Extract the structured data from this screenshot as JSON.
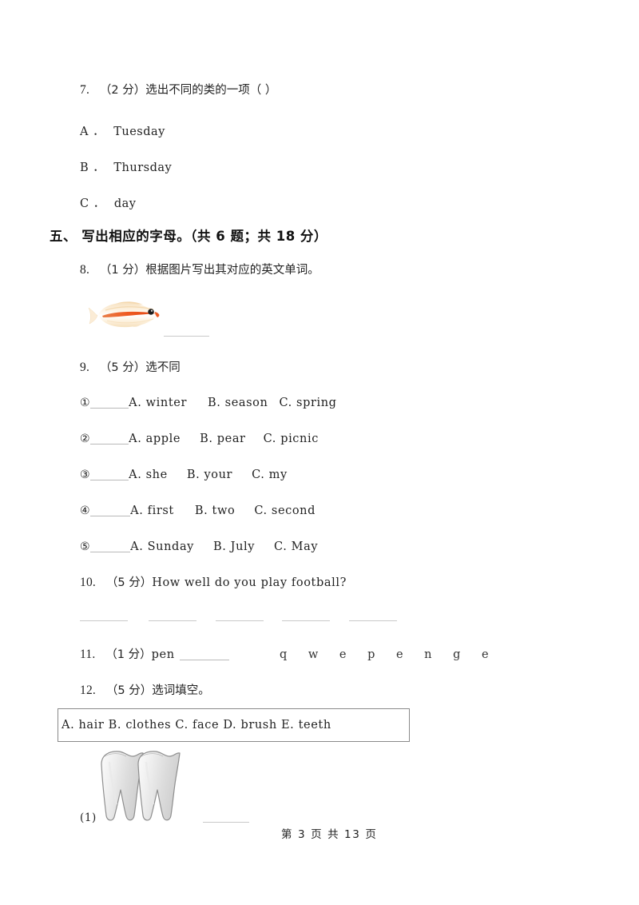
{
  "page": {
    "footer": "第 3 页 共 13 页",
    "page_number": 3,
    "total_pages": 13,
    "background": "#ffffff"
  },
  "question7": {
    "number": "7.",
    "score": "（2 分）",
    "prompt": "选出不同的类的一项（      ）",
    "options": [
      {
        "label": "A ．",
        "text": "Tuesday"
      },
      {
        "label": "B ．",
        "text": "Thursday"
      },
      {
        "label": "C ．",
        "text": "day"
      }
    ]
  },
  "section5": {
    "title": "五、  写出相应的字母。（共 6 题；共 18 分）"
  },
  "question8": {
    "number": "8.",
    "score": "（1 分）",
    "prompt": "根据图片写出其对应的英文单词。",
    "image": "fish-illustration",
    "answer_blank": ""
  },
  "question9": {
    "number": "9.",
    "score": "（5 分）",
    "prompt": "选不同",
    "items": [
      {
        "marker": "①",
        "a": "A. winter",
        "b": "B. season",
        "c": "C. spring"
      },
      {
        "marker": "②",
        "a": "A. apple",
        "b": "B. pear",
        "c": "C. picnic"
      },
      {
        "marker": "③",
        "a": "A. she",
        "b": "B. your",
        "c": "C. my"
      },
      {
        "marker": "④",
        "a": "A. first",
        "b": "B. two",
        "c": "C. second"
      },
      {
        "marker": "⑤",
        "a": "A. Sunday",
        "b": "B. July",
        "c": "C. May"
      }
    ]
  },
  "question10": {
    "number": "10.",
    "score": "（5 分）",
    "prompt": "How well do you play football?",
    "blank_count": 5
  },
  "question11": {
    "number": "11.",
    "score": "（1 分）",
    "prompt": "pen",
    "letters": "q w e p e n g e"
  },
  "question12": {
    "number": "12.",
    "score": "（5 分）",
    "prompt": "选词填空。",
    "word_bank": "A. hair   B. clothes   C. face   D. brush   E. teeth",
    "sub_items": [
      {
        "marker": "(1)",
        "image": "teeth-illustration",
        "answer_blank": ""
      }
    ]
  }
}
